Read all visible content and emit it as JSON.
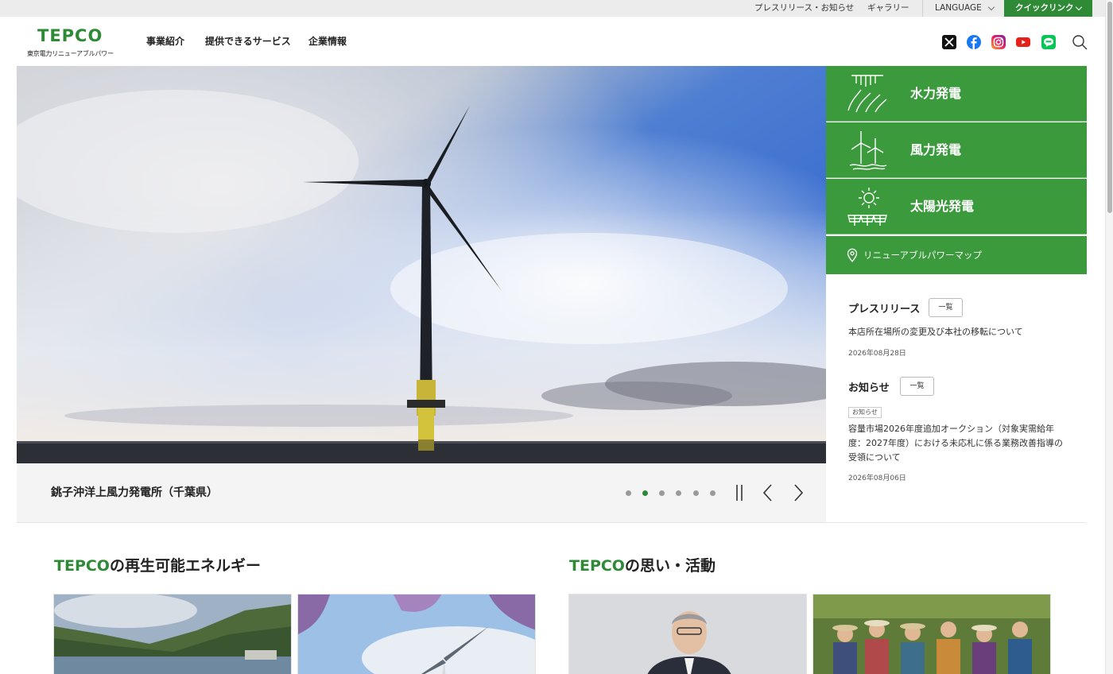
{
  "topbar": {
    "press_news": "プレスリリース・お知らせ",
    "gallery": "ギャラリー",
    "language": "LANGUAGE",
    "quick_link": "クイックリンク"
  },
  "header": {
    "logo_mark": "TEPCO",
    "logo_sub": "東京電力リニューアブルパワー",
    "nav": [
      "事業紹介",
      "提供できるサービス",
      "企業情報"
    ],
    "sns": [
      "x-icon",
      "facebook-icon",
      "instagram-icon",
      "youtube-icon",
      "line-icon"
    ]
  },
  "hero": {
    "caption": "銚子沖洋上風力発電所（千葉県）",
    "slide_count": 6,
    "active_slide": 2
  },
  "side": {
    "generation": [
      "水力発電",
      "風力発電",
      "太陽光発電"
    ],
    "map_link": "リニューアブルパワーマップ",
    "press": {
      "title": "プレスリリース",
      "list_label": "一覧",
      "item_text": "本店所在場所の変更及び本社の移転について",
      "item_date": "2026年08月28日"
    },
    "notice": {
      "title": "お知らせ",
      "list_label": "一覧",
      "tag": "お知らせ",
      "item_text": "容量市場2026年度追加オークション（対象実需給年度：2027年度）における未応札に係る業務改善指導の受領について",
      "item_date": "2026年08月06日"
    }
  },
  "sections": {
    "renewable": {
      "brand": "TEPCO",
      "rest": "の再生可能エネルギー"
    },
    "activity": {
      "brand": "TEPCO",
      "rest": "の思い・活動"
    }
  },
  "colors": {
    "brand_green": "#2f8a36",
    "panel_green": "#3a9a3c"
  }
}
